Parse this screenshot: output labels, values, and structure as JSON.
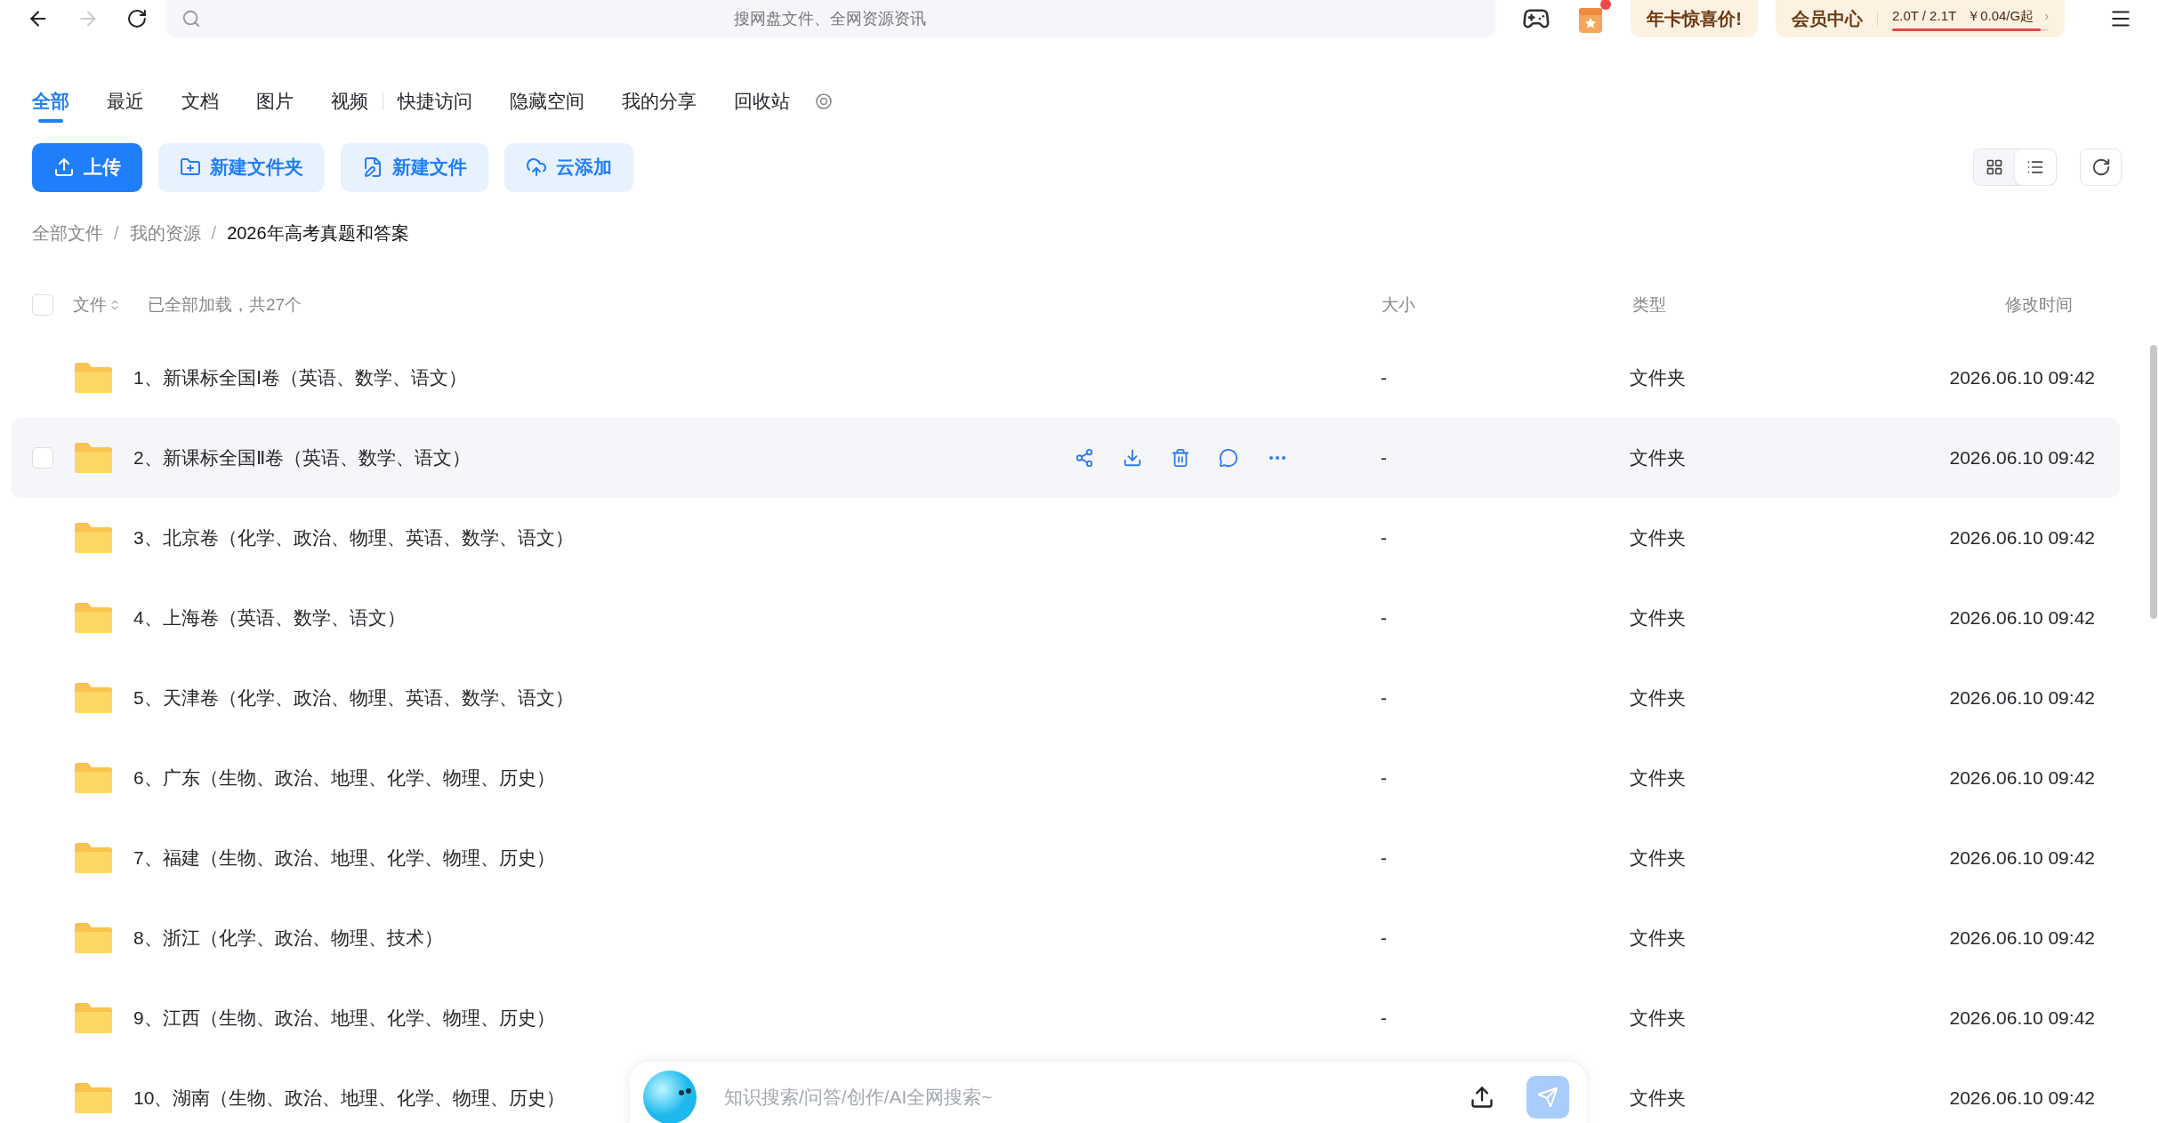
{
  "top_bar": {
    "search_placeholder": "搜网盘文件、全网资源资讯",
    "promo": "年卡惊喜价!",
    "member": "会员中心",
    "storage": "2.0T / 2.1T",
    "storage_bar": {
      "level": 0.95
    },
    "price": "￥0.04/G起",
    "price_caret": "›",
    "notification_dot": true
  },
  "tabs": [
    {
      "label": "全部",
      "selected": true
    },
    {
      "label": "最近",
      "selected": false
    },
    {
      "label": "文档",
      "selected": false
    },
    {
      "label": "图片",
      "selected": false
    },
    {
      "label": "视频",
      "selected": false
    },
    {
      "label": "快捷访问",
      "selected": false
    },
    {
      "label": "隐藏空间",
      "selected": false
    },
    {
      "label": "我的分享",
      "selected": false
    },
    {
      "label": "回收站",
      "selected": false
    }
  ],
  "actions": [
    {
      "kind": "upload",
      "label": "上传"
    },
    {
      "kind": "folder",
      "label": "新建文件夹"
    },
    {
      "kind": "file",
      "label": "新建文件"
    },
    {
      "kind": "cloud",
      "label": "云添加"
    }
  ],
  "view_toggle": [
    {
      "kind": "grid",
      "selected": false
    },
    {
      "kind": "list",
      "selected": true
    }
  ],
  "breadcrumb": [
    {
      "label": "全部文件"
    },
    {
      "label": "我的资源"
    },
    {
      "label": "2026年高考真题和答案"
    }
  ],
  "breadcrumb_separator": "/",
  "table": {
    "select_all": {
      "checked": false
    },
    "columns": [
      "文件",
      "大小",
      "类型",
      "修改时间"
    ],
    "status": "已全部加载，共27个",
    "rows": [
      {
        "name": "1、新课标全国Ⅰ卷（英语、数学、语文）",
        "size": "-",
        "type": "文件夹",
        "modified": "2026.06.10 09:42",
        "hovered": false
      },
      {
        "name": "2、新课标全国Ⅱ卷（英语、数学、语文）",
        "size": "-",
        "type": "文件夹",
        "modified": "2026.06.10 09:42",
        "hovered": true
      },
      {
        "name": "3、北京卷（化学、政治、物理、英语、数学、语文）",
        "size": "-",
        "type": "文件夹",
        "modified": "2026.06.10 09:42",
        "hovered": false
      },
      {
        "name": "4、上海卷（英语、数学、语文）",
        "size": "-",
        "type": "文件夹",
        "modified": "2026.06.10 09:42",
        "hovered": false
      },
      {
        "name": "5、天津卷（化学、政治、物理、英语、数学、语文）",
        "size": "-",
        "type": "文件夹",
        "modified": "2026.06.10 09:42",
        "hovered": false
      },
      {
        "name": "6、广东（生物、政治、地理、化学、物理、历史）",
        "size": "-",
        "type": "文件夹",
        "modified": "2026.06.10 09:42",
        "hovered": false
      },
      {
        "name": "7、福建（生物、政治、地理、化学、物理、历史）",
        "size": "-",
        "type": "文件夹",
        "modified": "2026.06.10 09:42",
        "hovered": false
      },
      {
        "name": "8、浙江（化学、政治、物理、技术）",
        "size": "-",
        "type": "文件夹",
        "modified": "2026.06.10 09:42",
        "hovered": false
      },
      {
        "name": "9、江西（生物、政治、地理、化学、物理、历史）",
        "size": "-",
        "type": "文件夹",
        "modified": "2026.06.10 09:42",
        "hovered": false
      },
      {
        "name": "10、湖南（生物、政治、地理、化学、物理、历史）",
        "type": "文件夹",
        "modified": "2026.06.10 09:42",
        "hovered": false
      }
    ]
  },
  "ai_bar": {
    "placeholder": "知识搜索/问答/创作/AI全网搜索~"
  }
}
